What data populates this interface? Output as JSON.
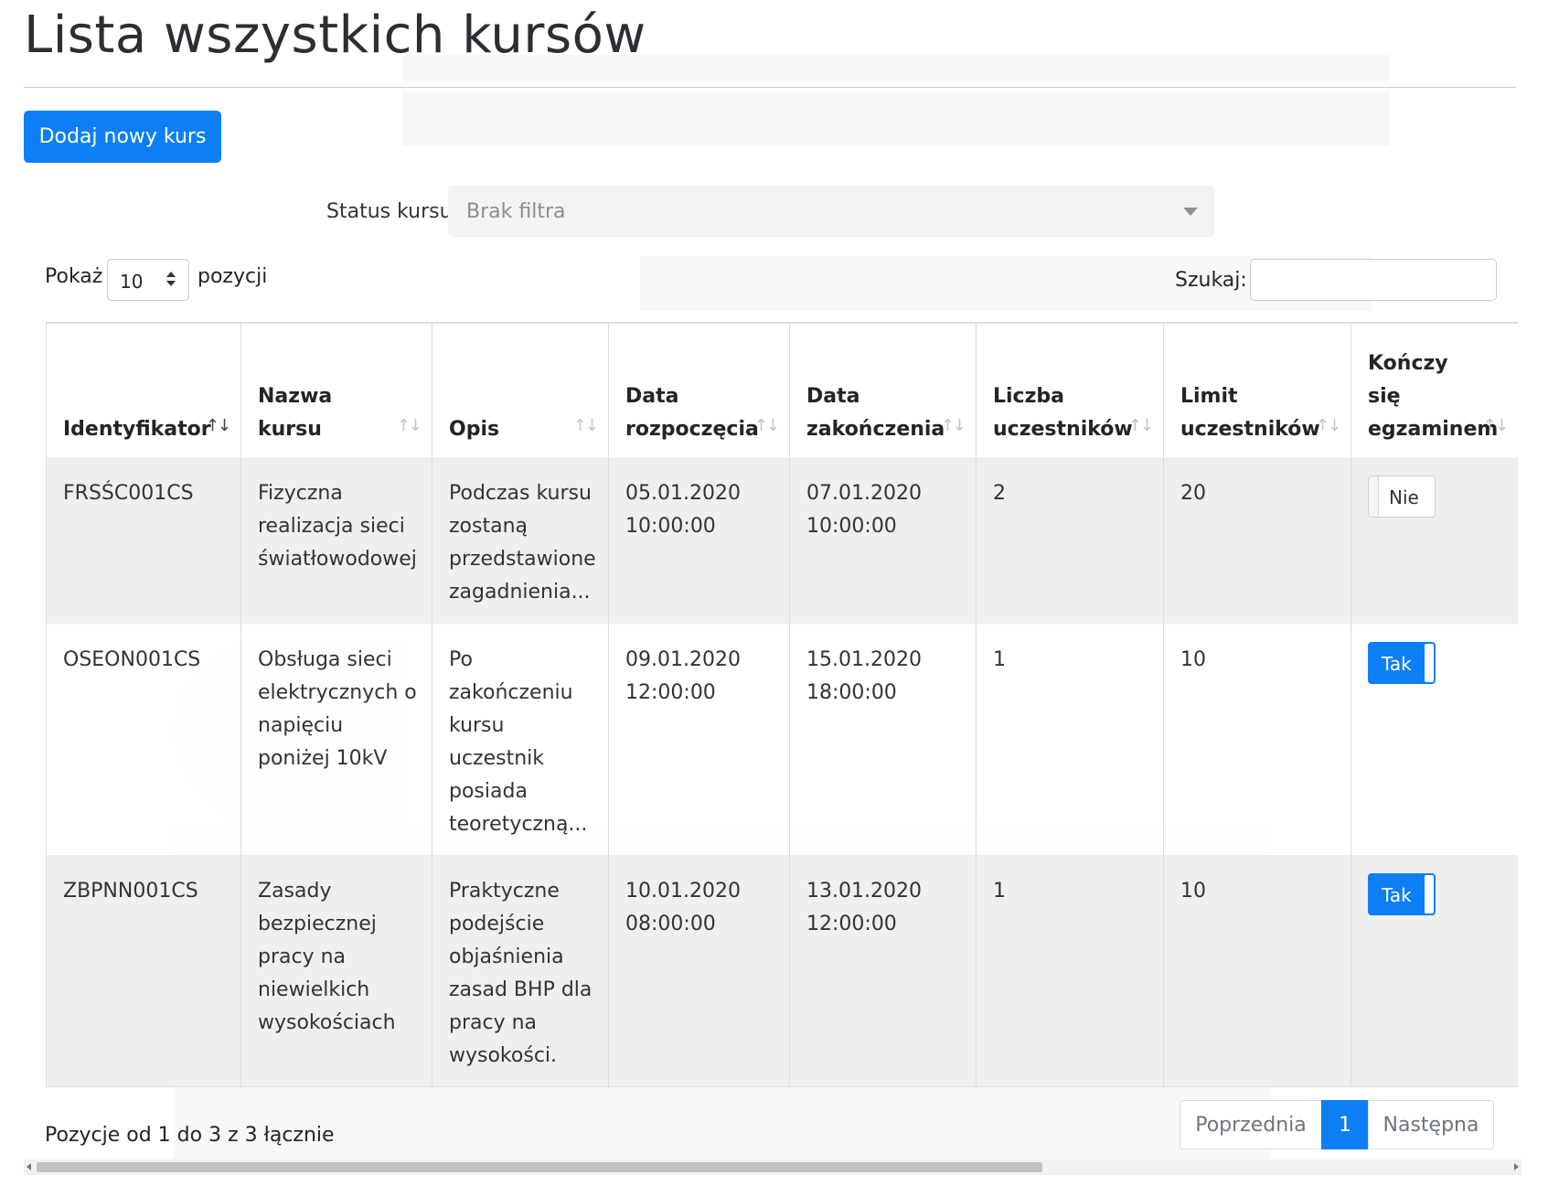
{
  "page": {
    "title": "Lista wszystkich kursów",
    "add_button": "Dodaj nowy kurs"
  },
  "filter": {
    "label": "Status kursu:",
    "selected": "Brak filtra"
  },
  "length": {
    "label_before": "Pokaż",
    "value": "10",
    "label_after": "pozycji"
  },
  "search": {
    "label": "Szukaj:",
    "value": ""
  },
  "table": {
    "columns": [
      {
        "label": "Identyfikator",
        "sort": "asc"
      },
      {
        "label": "Nazwa kursu",
        "sort": "none"
      },
      {
        "label": "Opis",
        "sort": "none"
      },
      {
        "label": "Data rozpoczęcia",
        "sort": "none"
      },
      {
        "label": "Data zakończenia",
        "sort": "none"
      },
      {
        "label": "Liczba uczestników",
        "sort": "none"
      },
      {
        "label": "Limit uczestników",
        "sort": "none"
      },
      {
        "label": "Kończy się egzaminem",
        "sort": "none"
      }
    ],
    "rows": [
      {
        "id": "FRSŚC001CS",
        "name": "Fizyczna realizacja sieci światłowodowej",
        "description": "Podczas kursu zostaną przedstawione zagadnienia...",
        "start": "05.01.2020 10:00:00",
        "end": "07.01.2020 10:00:00",
        "participants": "2",
        "limit": "20",
        "exam": "Nie"
      },
      {
        "id": "OSEON001CS",
        "name": "Obsługa sieci elektrycznych o napięciu poniżej 10kV",
        "description": "Po zakończeniu kursu uczestnik posiada teoretyczną...",
        "start": "09.01.2020 12:00:00",
        "end": "15.01.2020 18:00:00",
        "participants": "1",
        "limit": "10",
        "exam": "Tak"
      },
      {
        "id": "ZBPNN001CS",
        "name": "Zasady bezpiecznej pracy na niewielkich wysokościach",
        "description": "Praktyczne podejście objaśnienia zasad BHP dla pracy na wysokości.",
        "start": "10.01.2020 08:00:00",
        "end": "13.01.2020 12:00:00",
        "participants": "1",
        "limit": "10",
        "exam": "Tak"
      }
    ]
  },
  "footer": {
    "info": "Pozycje od 1 do 3 z 3 łącznie",
    "prev": "Poprzednia",
    "current_page": "1",
    "next": "Następna"
  },
  "colors": {
    "primary": "#0d7ff5",
    "odd_row": "#eeeeee",
    "border": "#dcdcdc"
  }
}
